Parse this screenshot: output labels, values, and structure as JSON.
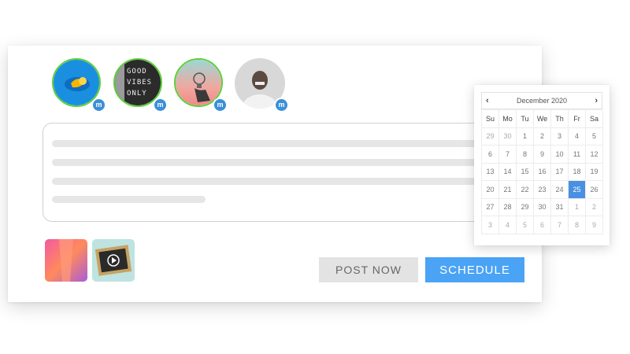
{
  "accounts": [
    {
      "name": "account-blue-shapes",
      "selected": true,
      "icon": "mastodon-icon"
    },
    {
      "name": "account-good-vibes",
      "selected": true,
      "icon": "mastodon-icon",
      "sign_text": [
        "GOOD",
        "VIBES",
        "ONLY"
      ]
    },
    {
      "name": "account-lightbulb",
      "selected": true,
      "icon": "mastodon-icon"
    },
    {
      "name": "account-person",
      "selected": false,
      "icon": "mastodon-icon"
    }
  ],
  "badge_glyph": "m",
  "buttons": {
    "post_now": "POST NOW",
    "schedule": "SCHEDULE"
  },
  "calendar": {
    "month_label": "December 2020",
    "prev_icon": "chevron-left-icon",
    "next_icon": "chevron-right-icon",
    "prev_glyph": "‹",
    "next_glyph": "›",
    "weekdays": [
      "Su",
      "Mo",
      "Tu",
      "We",
      "Th",
      "Fr",
      "Sa"
    ],
    "weeks": [
      [
        "29",
        "30",
        "1",
        "2",
        "3",
        "4",
        "5"
      ],
      [
        "6",
        "7",
        "8",
        "9",
        "10",
        "11",
        "12"
      ],
      [
        "13",
        "14",
        "15",
        "16",
        "17",
        "18",
        "19"
      ],
      [
        "20",
        "21",
        "22",
        "23",
        "24",
        "25",
        "26"
      ],
      [
        "27",
        "28",
        "29",
        "30",
        "31",
        "1",
        "2"
      ],
      [
        "3",
        "4",
        "5",
        "6",
        "7",
        "8",
        "9"
      ]
    ],
    "selected_day": "25"
  },
  "colors": {
    "accent": "#4aa3f5",
    "selected_day": "#4a90e2",
    "selected_ring": "#5ccf3a",
    "network_badge": "#3b8fd8"
  }
}
